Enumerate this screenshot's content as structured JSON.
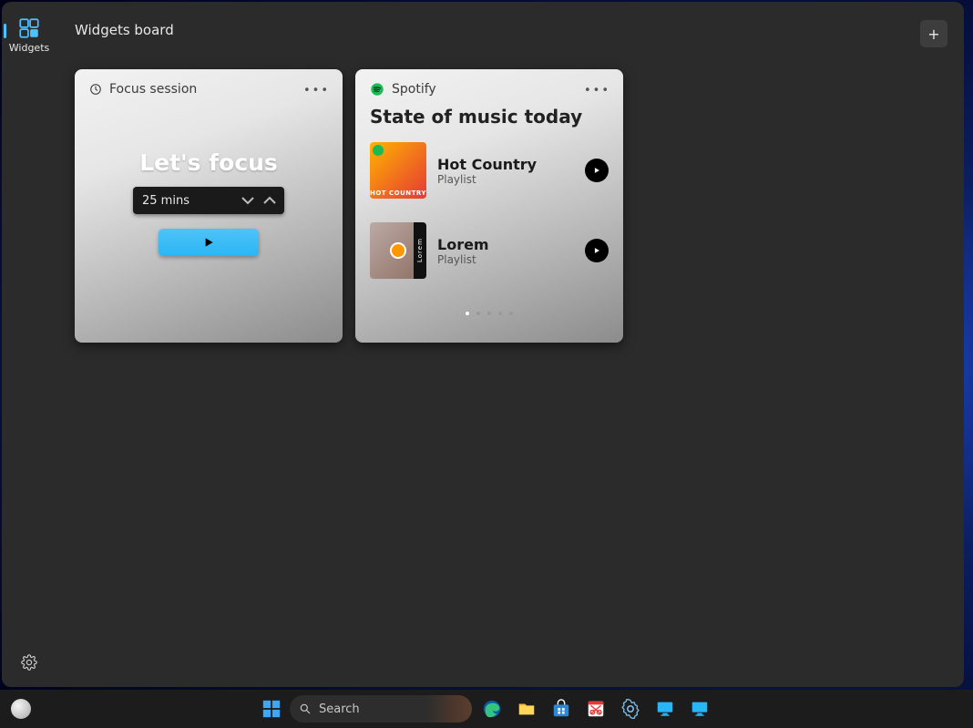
{
  "sidebar": {
    "widgets_label": "Widgets"
  },
  "header": {
    "title": "Widgets board",
    "add_label": "+"
  },
  "focus_widget": {
    "title": "Focus session",
    "heading": "Let's focus",
    "duration": "25 mins"
  },
  "spotify_widget": {
    "title": "Spotify",
    "heading": "State of music today",
    "playlists": [
      {
        "title": "Hot Country",
        "subtitle": "Playlist",
        "art_label": "HOT COUNTRY"
      },
      {
        "title": "Lorem",
        "subtitle": "Playlist",
        "art_side": "Lorem"
      }
    ]
  },
  "taskbar": {
    "search_placeholder": "Search"
  }
}
